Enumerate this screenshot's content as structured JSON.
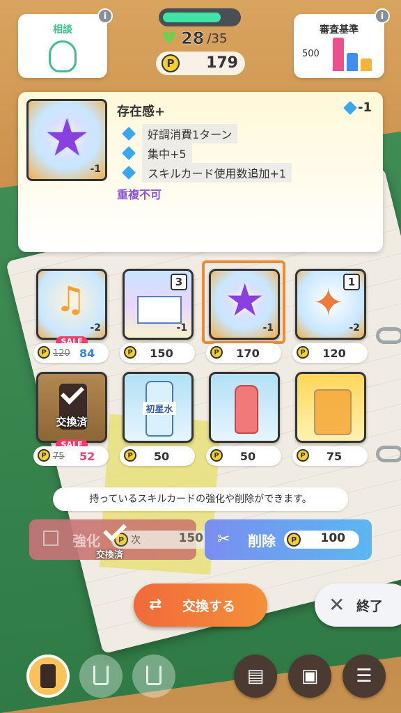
{
  "topbar": {
    "consult_label": "相談",
    "criteria_label": "審査基準",
    "criteria_value": "500",
    "hp_current": "28",
    "hp_max": "/35",
    "hp_fraction": 0.8,
    "coins": "179",
    "info": "i"
  },
  "detail": {
    "title": "存在感+",
    "cost": "-1",
    "card_cost": "-1",
    "effects": [
      {
        "text": "好調消費1ターン"
      },
      {
        "text": "集中+5"
      },
      {
        "text": "スキルカード使用数追加+1"
      }
    ],
    "note": "重複不可"
  },
  "shop": {
    "coin_symbol": "P",
    "sale_label": "SALE",
    "owned_label": "交換済",
    "cards": [
      {
        "name": "music-card",
        "old_price": "120",
        "price": "84",
        "sale": true,
        "cost": "-2",
        "level": ""
      },
      {
        "name": "poster-card",
        "price": "150",
        "level": "3",
        "cost": "-1"
      },
      {
        "name": "presence-card",
        "price": "170",
        "cost": "-1",
        "level": ""
      },
      {
        "name": "dance-card",
        "price": "120",
        "level": "1",
        "cost": "-2"
      }
    ],
    "drinks": [
      {
        "name": "can-drink",
        "old_price": "75",
        "price": "52",
        "sale": true,
        "owned": true
      },
      {
        "name": "water-bottle",
        "price": "50",
        "label": "初星水"
      },
      {
        "name": "juice-bottle",
        "price": "50"
      },
      {
        "name": "fruit-tea",
        "price": "75"
      }
    ]
  },
  "hint": "持っているスキルカードの強化や削除ができます。",
  "actions": {
    "enhance_label": "強化",
    "enhance_next": "次",
    "enhance_price": "150",
    "enhance_owned": "交換済",
    "delete_label": "削除",
    "delete_price": "100",
    "exchange_label": "交換する",
    "end_label": "終了"
  }
}
